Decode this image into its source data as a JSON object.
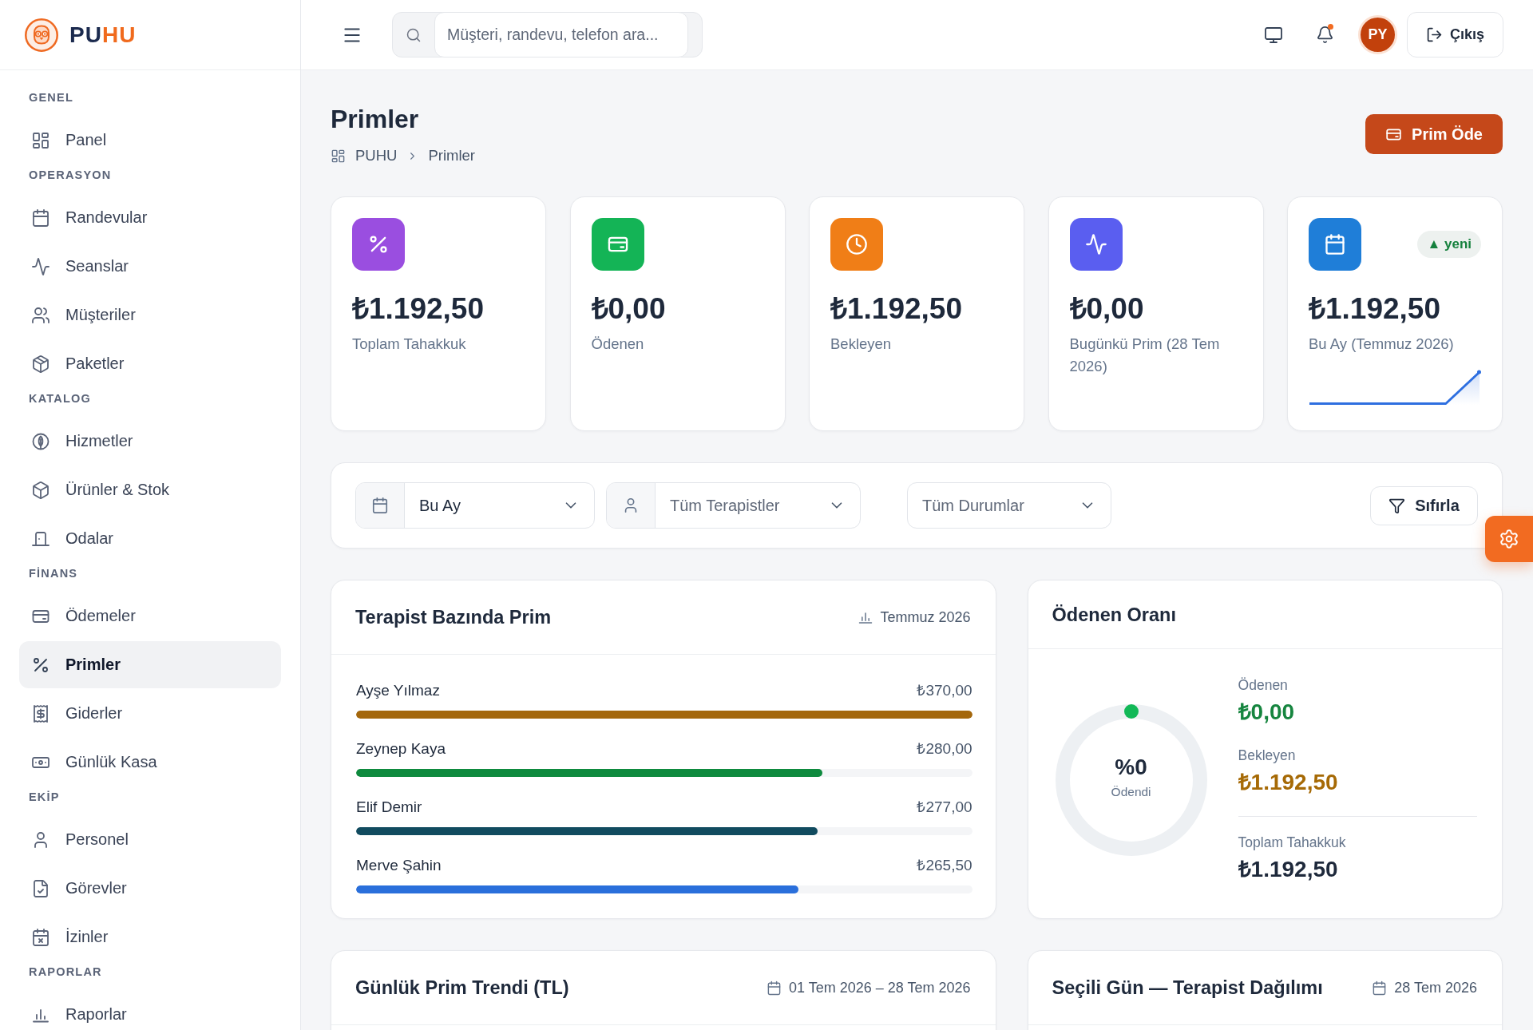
{
  "brand": {
    "parts": [
      {
        "text": "PU",
        "accent": false
      },
      {
        "text": "HU",
        "accent": true
      }
    ]
  },
  "sidebar": {
    "sections": [
      {
        "title": "GENEL",
        "items": [
          {
            "label": "Panel",
            "selected": false
          }
        ]
      },
      {
        "title": "OPERASYON",
        "items": [
          {
            "label": "Randevular",
            "selected": false
          },
          {
            "label": "Seanslar",
            "selected": false
          },
          {
            "label": "Müşteriler",
            "selected": false
          },
          {
            "label": "Paketler",
            "selected": false
          }
        ]
      },
      {
        "title": "KATALOG",
        "items": [
          {
            "label": "Hizmetler",
            "selected": false
          },
          {
            "label": "Ürünler & Stok",
            "selected": false
          },
          {
            "label": "Odalar",
            "selected": false
          }
        ]
      },
      {
        "title": "FİNANS",
        "items": [
          {
            "label": "Ödemeler",
            "selected": false
          },
          {
            "label": "Primler",
            "selected": true
          },
          {
            "label": "Giderler",
            "selected": false
          },
          {
            "label": "Günlük Kasa",
            "selected": false
          }
        ]
      },
      {
        "title": "EKİP",
        "items": [
          {
            "label": "Personel",
            "selected": false
          },
          {
            "label": "Görevler",
            "selected": false
          },
          {
            "label": "İzinler",
            "selected": false
          }
        ]
      },
      {
        "title": "RAPORLAR",
        "items": [
          {
            "label": "Raporlar",
            "selected": false
          }
        ]
      }
    ]
  },
  "topbar": {
    "search": {
      "placeholder": "Müşteri, randevu, telefon ara..."
    },
    "notifications_unread": true,
    "avatar": "PY",
    "logout": "Çıkış"
  },
  "page": {
    "title": "Primler",
    "breadcrumb": [
      "PUHU",
      "Primler"
    ],
    "primary_action": "Prim Öde"
  },
  "stats": [
    {
      "kind": "plain",
      "value": "₺1.192,50",
      "label": "Toplam Tahakkuk",
      "color": "#9a4ee0"
    },
    {
      "kind": "plain",
      "value": "₺0,00",
      "label": "Ödenen",
      "color": "#14b456"
    },
    {
      "kind": "plain",
      "value": "₺1.192,50",
      "label": "Bekleyen",
      "color": "#f07e17"
    },
    {
      "kind": "plain",
      "value": "₺0,00",
      "label": "Bugünkü Prim (28 Tem 2026)",
      "color": "#5a5ef0"
    },
    {
      "kind": "trend",
      "value": "₺1.192,50",
      "label": "Bu Ay (Temmuz 2026)",
      "color": "#1f7ed8",
      "badge": "▲ yeni"
    }
  ],
  "filters": {
    "selects": [
      {
        "kind": "date",
        "value": "Bu Ay"
      },
      {
        "kind": "therapist",
        "placeholder": "Tüm Terapistler"
      },
      {
        "kind": "status",
        "placeholder": "Tüm Durumlar"
      }
    ],
    "reset": "Sıfırla"
  },
  "therapist_panel": {
    "title": "Terapist Bazında Prim",
    "period": "Temmuz 2026",
    "rows": [
      {
        "name": "Ayşe Yılmaz",
        "amount": "₺370,00",
        "level": 1,
        "color": "#a4670c"
      },
      {
        "name": "Zeynep Kaya",
        "amount": "₺280,00",
        "level": 0.757,
        "color": "#0e8a3e"
      },
      {
        "name": "Elif Demir",
        "amount": "₺277,00",
        "level": 0.749,
        "color": "#114b5f"
      },
      {
        "name": "Merve Şahin",
        "amount": "₺265,50",
        "level": 0.718,
        "color": "#2a6fdb"
      }
    ]
  },
  "ratio_panel": {
    "title": "Ödenen Oranı",
    "percent": "%0",
    "caption": "Ödendi",
    "figures": [
      {
        "kind": "paid",
        "label": "Ödenen",
        "value": "₺0,00"
      },
      {
        "kind": "pending",
        "label": "Bekleyen",
        "value": "₺1.192,50"
      },
      {
        "kind": "total",
        "label": "Toplam Tahakkuk",
        "value": "₺1.192,50"
      }
    ]
  },
  "bottom_panels": [
    {
      "title": "Günlük Prim Trendi (TL)",
      "period": "01 Tem 2026 – 28 Tem 2026"
    },
    {
      "title": "Seçili Gün — Terapist Dağılımı",
      "period": "28 Tem 2026"
    }
  ]
}
